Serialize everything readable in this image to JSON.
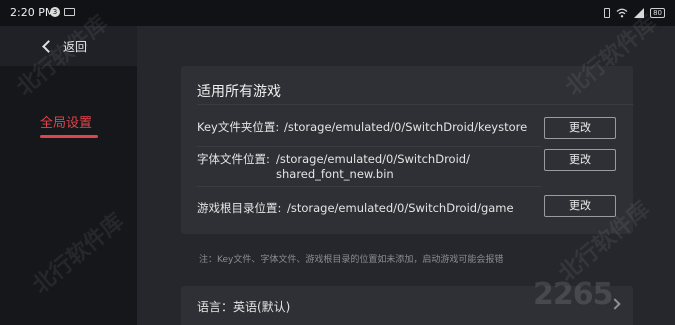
{
  "status_bar": {
    "time": "2:20 PM",
    "badge": "3",
    "battery": "80"
  },
  "sidebar": {
    "back_label": "返回",
    "items": [
      {
        "label": "全局设置",
        "active": true
      }
    ]
  },
  "card": {
    "title": "适用所有游戏",
    "rows": [
      {
        "label": "Key文件夹位置:",
        "path_line1": "/storage/emulated/0/SwitchDroid/keystore",
        "path_line2": "",
        "button": "更改"
      },
      {
        "label": "字体文件位置:",
        "path_line1": "/storage/emulated/0/SwitchDroid/",
        "path_line2": "shared_font_new.bin",
        "button": "更改"
      },
      {
        "label": "游戏根目录位置:",
        "path_line1": "/storage/emulated/0/SwitchDroid/game",
        "path_line2": "",
        "button": "更改"
      }
    ]
  },
  "note": "注：Key文件、字体文件、游戏根目录的位置如未添加，启动游戏可能会报错",
  "language": {
    "label": "语言：英语(默认)"
  },
  "watermark": {
    "text": "北行软件库",
    "logo": "2265"
  },
  "colors": {
    "accent": "#e0434a",
    "background": "#16171b",
    "panel": "#26272c",
    "card": "#2f3035"
  }
}
